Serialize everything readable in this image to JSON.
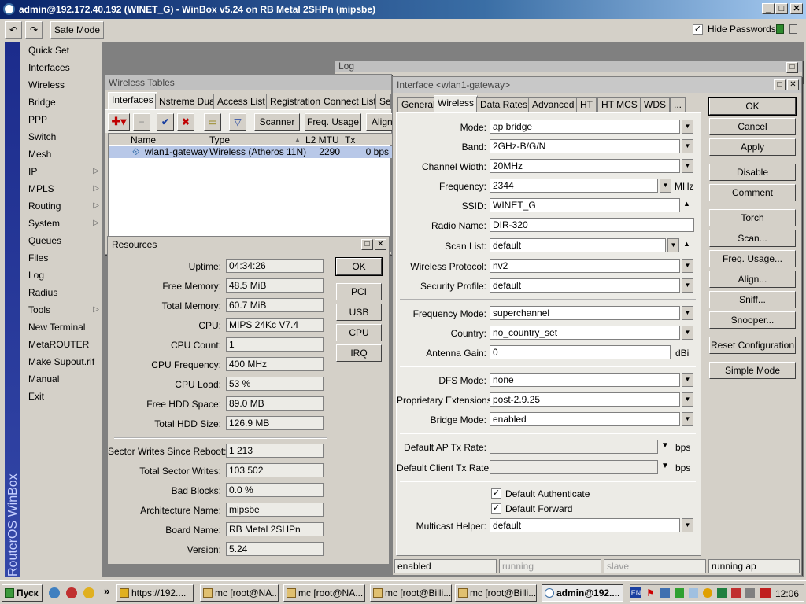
{
  "window": {
    "title": "admin@192.172.40.192 (WINET_G) - WinBox v5.24 on RB Metal 2SHPn (mipsbe)"
  },
  "toolbar": {
    "undo_icon": "undo-icon",
    "redo_icon": "redo-icon",
    "safe_mode": "Safe Mode",
    "hide_passwords": "Hide Passwords",
    "hide_passwords_checked": true
  },
  "brand": "RouterOS WinBox",
  "menu": [
    {
      "label": "Quick Set",
      "sub": false
    },
    {
      "label": "Interfaces",
      "sub": false
    },
    {
      "label": "Wireless",
      "sub": false
    },
    {
      "label": "Bridge",
      "sub": false
    },
    {
      "label": "PPP",
      "sub": false
    },
    {
      "label": "Switch",
      "sub": false
    },
    {
      "label": "Mesh",
      "sub": false
    },
    {
      "label": "IP",
      "sub": true
    },
    {
      "label": "MPLS",
      "sub": true
    },
    {
      "label": "Routing",
      "sub": true
    },
    {
      "label": "System",
      "sub": true
    },
    {
      "label": "Queues",
      "sub": false
    },
    {
      "label": "Files",
      "sub": false
    },
    {
      "label": "Log",
      "sub": false
    },
    {
      "label": "Radius",
      "sub": false
    },
    {
      "label": "Tools",
      "sub": true
    },
    {
      "label": "New Terminal",
      "sub": false
    },
    {
      "label": "MetaROUTER",
      "sub": false
    },
    {
      "label": "Make Supout.rif",
      "sub": false
    },
    {
      "label": "Manual",
      "sub": false
    },
    {
      "label": "Exit",
      "sub": false
    }
  ],
  "log_window": {
    "title": "Log"
  },
  "wireless_tables": {
    "title": "Wireless Tables",
    "tabs": [
      "Interfaces",
      "Nstreme Dual",
      "Access List",
      "Registration",
      "Connect List",
      "Sec"
    ],
    "buttons": {
      "scanner": "Scanner",
      "freq_usage": "Freq. Usage",
      "align": "Align"
    },
    "columns": [
      "Name",
      "Type",
      "L2 MTU",
      "Tx"
    ],
    "rows": [
      {
        "name": "wlan1-gateway",
        "type": "Wireless (Atheros 11N)",
        "l2mtu": "2290",
        "tx": "0 bps"
      }
    ]
  },
  "resources": {
    "title": "Resources",
    "fields": [
      {
        "label": "Uptime:",
        "value": "04:34:26"
      },
      {
        "label": "Free Memory:",
        "value": "48.5 MiB"
      },
      {
        "label": "Total Memory:",
        "value": "60.7 MiB"
      },
      {
        "label": "CPU:",
        "value": "MIPS 24Kc V7.4"
      },
      {
        "label": "CPU Count:",
        "value": "1"
      },
      {
        "label": "CPU Frequency:",
        "value": "400 MHz"
      },
      {
        "label": "CPU Load:",
        "value": "53 %"
      },
      {
        "label": "Free HDD Space:",
        "value": "89.0 MB"
      },
      {
        "label": "Total HDD Size:",
        "value": "126.9 MB"
      }
    ],
    "fields2": [
      {
        "label": "Sector Writes Since Reboot:",
        "value": "1 213"
      },
      {
        "label": "Total Sector Writes:",
        "value": "103 502"
      },
      {
        "label": "Bad Blocks:",
        "value": "0.0 %"
      },
      {
        "label": "Architecture Name:",
        "value": "mipsbe"
      },
      {
        "label": "Board Name:",
        "value": "RB Metal 2SHPn"
      },
      {
        "label": "Version:",
        "value": "5.24"
      }
    ],
    "buttons": [
      "OK",
      "PCI",
      "USB",
      "CPU",
      "IRQ"
    ]
  },
  "interface": {
    "title": "Interface <wlan1-gateway>",
    "tabs": [
      "General",
      "Wireless",
      "Data Rates",
      "Advanced",
      "HT",
      "HT MCS",
      "WDS",
      "..."
    ],
    "fields": {
      "mode": {
        "label": "Mode:",
        "value": "ap bridge"
      },
      "band": {
        "label": "Band:",
        "value": "2GHz-B/G/N"
      },
      "channel_width": {
        "label": "Channel Width:",
        "value": "20MHz"
      },
      "frequency": {
        "label": "Frequency:",
        "value": "2344",
        "unit": "MHz"
      },
      "ssid": {
        "label": "SSID:",
        "value": "WINET_G"
      },
      "radio_name": {
        "label": "Radio Name:",
        "value": "DIR-320"
      },
      "scan_list": {
        "label": "Scan List:",
        "value": "default"
      },
      "wireless_protocol": {
        "label": "Wireless Protocol:",
        "value": "nv2"
      },
      "security_profile": {
        "label": "Security Profile:",
        "value": "default"
      },
      "frequency_mode": {
        "label": "Frequency Mode:",
        "value": "superchannel"
      },
      "country": {
        "label": "Country:",
        "value": "no_country_set"
      },
      "antenna_gain": {
        "label": "Antenna Gain:",
        "value": "0",
        "unit": "dBi"
      },
      "dfs_mode": {
        "label": "DFS Mode:",
        "value": "none"
      },
      "proprietary_extensions": {
        "label": "Proprietary Extensions:",
        "value": "post-2.9.25"
      },
      "bridge_mode": {
        "label": "Bridge Mode:",
        "value": "enabled"
      },
      "default_ap_tx_rate": {
        "label": "Default AP Tx Rate:",
        "value": "",
        "unit": "bps"
      },
      "default_client_tx_rate": {
        "label": "Default Client Tx Rate:",
        "value": "",
        "unit": "bps"
      },
      "default_authenticate": {
        "label": "Default Authenticate",
        "checked": true
      },
      "default_forward": {
        "label": "Default Forward",
        "checked": true
      },
      "multicast_helper": {
        "label": "Multicast Helper:",
        "value": "default"
      }
    },
    "buttons": [
      "OK",
      "Cancel",
      "Apply",
      "Disable",
      "Comment",
      "Torch",
      "Scan...",
      "Freq. Usage...",
      "Align...",
      "Sniff...",
      "Snooper...",
      "Reset Configuration",
      "Simple Mode"
    ],
    "status": [
      "enabled",
      "running",
      "slave",
      "running ap"
    ]
  },
  "taskbar": {
    "start": "Пуск",
    "tasks": [
      {
        "label": "https://192....",
        "active": false
      },
      {
        "label": "mc [root@NA...",
        "active": false
      },
      {
        "label": "mc [root@NA...",
        "active": false
      },
      {
        "label": "mc [root@Billi...",
        "active": false
      },
      {
        "label": "mc [root@Billi...",
        "active": false
      },
      {
        "label": "admin@192....",
        "active": true
      }
    ],
    "lang": "EN",
    "clock": "12:06"
  }
}
